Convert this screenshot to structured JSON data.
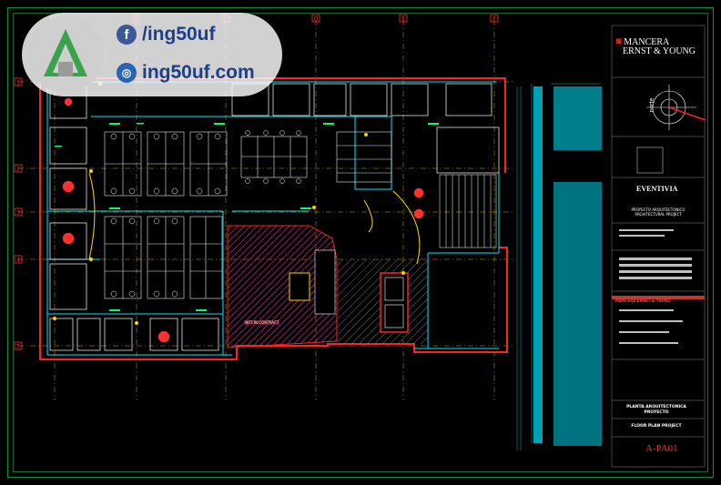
{
  "watermark": {
    "facebook_handle": "/ing50uf",
    "website": "ing50uf.com",
    "facebook_icon": "facebook-icon",
    "web_icon": "globe-icon"
  },
  "title_block": {
    "firm_name_line1": "MANCERA",
    "firm_name_line2": "ERNST & YOUNG",
    "project_name": "EVENTIVIA",
    "project_subtitle": "PROYECTO ARQUITECTONICO ARCHITECTURAL PROJECT",
    "client_band": "MANCERA ERNST & YOUNG",
    "plan_title": "PLANTA ARQUITECTONICA PROYECTO",
    "sheet_title": "FLOOR PLAN PROJECT",
    "sheet_number": "A-PA01",
    "north_label": "norte"
  },
  "grid": {
    "column_labels": [
      "A",
      "B",
      "C",
      "D",
      "E",
      "F"
    ],
    "row_labels": [
      "1",
      "2",
      "3",
      "4",
      "5"
    ]
  },
  "plan": {
    "hatched_area_label": "NOT IN CONTRACT"
  },
  "colors": {
    "walls": "#ff2020",
    "furniture": "#ffffff",
    "glazing": "#00e5ff",
    "grid_lines": "#ffd400",
    "annotations": "#00ff66",
    "frame": "#0a8f3a"
  }
}
